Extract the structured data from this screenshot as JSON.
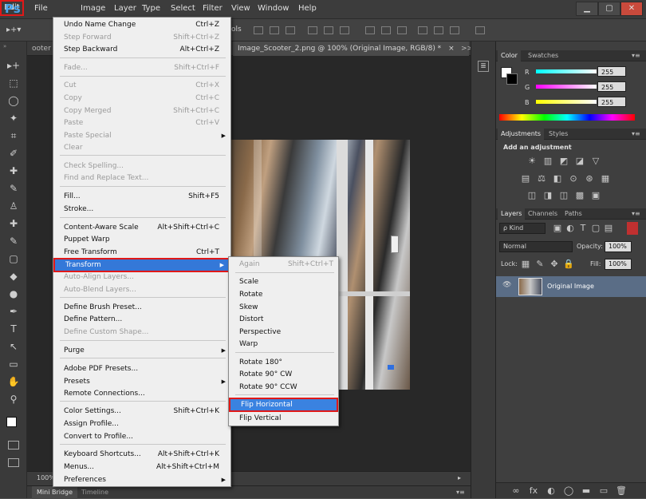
{
  "app": {
    "logo": "Ps"
  },
  "menubar": {
    "items": [
      "File",
      "Edit",
      "Image",
      "Layer",
      "Type",
      "Select",
      "Filter",
      "View",
      "Window",
      "Help"
    ],
    "window_controls": [
      "▁",
      "▢",
      "✕"
    ]
  },
  "options_bar": {
    "fragment_left": "▸+▾",
    "fragment_mid": "ols"
  },
  "document": {
    "tab_left": "ooter",
    "tab_active": "Image_Scooter_2.png @ 100% (Original Image, RGB/8) *",
    "tab_close": "×",
    "tab_scroll": ">>",
    "zoom": "100%",
    "status_arrow": "▸"
  },
  "bottom_tabs": {
    "mini_bridge": "Mini Bridge",
    "timeline": "Timeline"
  },
  "edit_menu": {
    "items": [
      {
        "label": "Undo Name Change",
        "shortcut": "Ctrl+Z",
        "disabled": false
      },
      {
        "label": "Step Forward",
        "shortcut": "Shift+Ctrl+Z",
        "disabled": true
      },
      {
        "label": "Step Backward",
        "shortcut": "Alt+Ctrl+Z",
        "disabled": false
      },
      {
        "label": "Fade...",
        "shortcut": "Shift+Ctrl+F",
        "disabled": true
      },
      {
        "label": "Cut",
        "shortcut": "Ctrl+X",
        "disabled": true
      },
      {
        "label": "Copy",
        "shortcut": "Ctrl+C",
        "disabled": true
      },
      {
        "label": "Copy Merged",
        "shortcut": "Shift+Ctrl+C",
        "disabled": true
      },
      {
        "label": "Paste",
        "shortcut": "Ctrl+V",
        "disabled": true
      },
      {
        "label": "Paste Special",
        "shortcut": "",
        "disabled": true
      },
      {
        "label": "Clear",
        "shortcut": "",
        "disabled": true
      },
      {
        "label": "Check Spelling...",
        "shortcut": "",
        "disabled": true
      },
      {
        "label": "Find and Replace Text...",
        "shortcut": "",
        "disabled": true
      },
      {
        "label": "Fill...",
        "shortcut": "Shift+F5",
        "disabled": false
      },
      {
        "label": "Stroke...",
        "shortcut": "",
        "disabled": false
      },
      {
        "label": "Content-Aware Scale",
        "shortcut": "Alt+Shift+Ctrl+C",
        "disabled": false
      },
      {
        "label": "Puppet Warp",
        "shortcut": "",
        "disabled": false
      },
      {
        "label": "Free Transform",
        "shortcut": "Ctrl+T",
        "disabled": false
      },
      {
        "label": "Transform",
        "shortcut": "",
        "disabled": false
      },
      {
        "label": "Auto-Align Layers...",
        "shortcut": "",
        "disabled": true
      },
      {
        "label": "Auto-Blend Layers...",
        "shortcut": "",
        "disabled": true
      },
      {
        "label": "Define Brush Preset...",
        "shortcut": "",
        "disabled": false
      },
      {
        "label": "Define Pattern...",
        "shortcut": "",
        "disabled": false
      },
      {
        "label": "Define Custom Shape...",
        "shortcut": "",
        "disabled": true
      },
      {
        "label": "Purge",
        "shortcut": "",
        "disabled": false
      },
      {
        "label": "Adobe PDF Presets...",
        "shortcut": "",
        "disabled": false
      },
      {
        "label": "Presets",
        "shortcut": "",
        "disabled": false
      },
      {
        "label": "Remote Connections...",
        "shortcut": "",
        "disabled": false
      },
      {
        "label": "Color Settings...",
        "shortcut": "Shift+Ctrl+K",
        "disabled": false
      },
      {
        "label": "Assign Profile...",
        "shortcut": "",
        "disabled": false
      },
      {
        "label": "Convert to Profile...",
        "shortcut": "",
        "disabled": false
      },
      {
        "label": "Keyboard Shortcuts...",
        "shortcut": "Alt+Shift+Ctrl+K",
        "disabled": false
      },
      {
        "label": "Menus...",
        "shortcut": "Alt+Shift+Ctrl+M",
        "disabled": false
      },
      {
        "label": "Preferences",
        "shortcut": "",
        "disabled": false
      }
    ],
    "submenu_arrow": "▶"
  },
  "transform_menu": {
    "items": [
      {
        "label": "Again",
        "shortcut": "Shift+Ctrl+T",
        "disabled": true
      },
      {
        "label": "Scale",
        "shortcut": "",
        "disabled": false
      },
      {
        "label": "Rotate",
        "shortcut": "",
        "disabled": false
      },
      {
        "label": "Skew",
        "shortcut": "",
        "disabled": false
      },
      {
        "label": "Distort",
        "shortcut": "",
        "disabled": false
      },
      {
        "label": "Perspective",
        "shortcut": "",
        "disabled": false
      },
      {
        "label": "Warp",
        "shortcut": "",
        "disabled": false
      },
      {
        "label": "Rotate 180°",
        "shortcut": "",
        "disabled": false
      },
      {
        "label": "Rotate 90° CW",
        "shortcut": "",
        "disabled": false
      },
      {
        "label": "Rotate 90° CCW",
        "shortcut": "",
        "disabled": false
      },
      {
        "label": "Flip Horizontal",
        "shortcut": "",
        "disabled": false
      },
      {
        "label": "Flip Vertical",
        "shortcut": "",
        "disabled": false
      }
    ]
  },
  "color_panel": {
    "tabs": [
      "Color",
      "Swatches"
    ],
    "channels": [
      {
        "label": "R",
        "value": "255"
      },
      {
        "label": "G",
        "value": "255"
      },
      {
        "label": "B",
        "value": "255"
      }
    ]
  },
  "adjustments_panel": {
    "tabs": [
      "Adjustments",
      "Styles"
    ],
    "heading": "Add an adjustment",
    "icon_row1": [
      "☀",
      "▥",
      "◩",
      "◪",
      "▽"
    ],
    "icon_row2": [
      "▤",
      "⚖",
      "◧",
      "⊙",
      "⊛",
      "▦"
    ],
    "icon_row3": [
      "◫",
      "◨",
      "◫",
      "▩",
      "▣"
    ]
  },
  "layers_panel": {
    "tabs": [
      "Layers",
      "Channels",
      "Paths"
    ],
    "filter_label": "ρ Kind",
    "filter_icons": [
      "▣",
      "◐",
      "T",
      "▢",
      "▤"
    ],
    "blend_mode": "Normal",
    "opacity_label": "Opacity:",
    "opacity_value": "100%",
    "lock_label": "Lock:",
    "lock_icons": [
      "▦",
      "✎",
      "✥",
      "🔒"
    ],
    "fill_label": "Fill:",
    "fill_value": "100%",
    "layer_name": "Original Image",
    "eye": "👁",
    "footer_icons": [
      "∞",
      "fx",
      "◐",
      "◯",
      "▬",
      "▭",
      "🗑"
    ]
  },
  "panel_menu_glyph": "▾≡",
  "tools": [
    "▸+",
    "⬚",
    "◯",
    "✦",
    "⌗",
    "✐",
    "✚",
    "✎",
    "♙",
    "✚",
    "✎",
    "▢",
    "◆",
    "●",
    "✒",
    "T",
    "↖",
    "▭",
    "✋",
    "⚲"
  ]
}
